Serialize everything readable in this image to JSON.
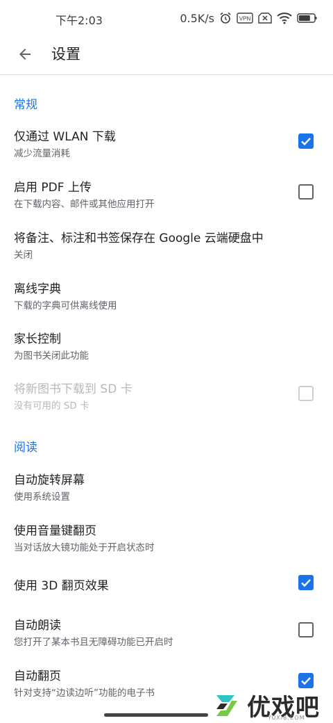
{
  "status_bar": {
    "time": "下午2:03",
    "net_speed": "0.5K/s",
    "vpn_label": "VPN",
    "battery_level": 0.75
  },
  "header": {
    "title": "设置"
  },
  "sections": {
    "general": {
      "title": "常规",
      "items": [
        {
          "title": "仅通过 WLAN 下载",
          "summary": "减少流量消耗",
          "checked": true
        },
        {
          "title": "启用 PDF 上传",
          "summary": "在下载内容、邮件或其他应用打开",
          "checked": false
        },
        {
          "title": "将备注、标注和书签保存在 Google 云端硬盘中",
          "summary": "关闭"
        },
        {
          "title": "离线字典",
          "summary": "下载的字典可供离线使用"
        },
        {
          "title": "家长控制",
          "summary": "为图书关闭此功能"
        },
        {
          "title": "将新图书下载到 SD 卡",
          "summary": "没有可用的 SD 卡",
          "checked": false,
          "enabled": false
        }
      ]
    },
    "reading": {
      "title": "阅读",
      "items": [
        {
          "title": "自动旋转屏幕",
          "summary": "使用系统设置"
        },
        {
          "title": "使用音量键翻页",
          "summary": "当对话放大镜功能处于开启状态时"
        },
        {
          "title": "使用 3D 翻页效果",
          "checked": true
        },
        {
          "title": "自动朗读",
          "summary": "您打开了某本书且无障碍功能已开启时",
          "checked": false
        },
        {
          "title": "自动翻页",
          "summary": "针对支持“边读边听”功能的电子书",
          "checked": true
        }
      ]
    }
  },
  "watermark": {
    "text": "优戏吧",
    "sub": "YOXI8.COM"
  },
  "colors": {
    "accent": "#1a73e8",
    "text_primary": "#202124",
    "text_secondary": "#5f6368",
    "disabled": "#b8b8b8"
  }
}
